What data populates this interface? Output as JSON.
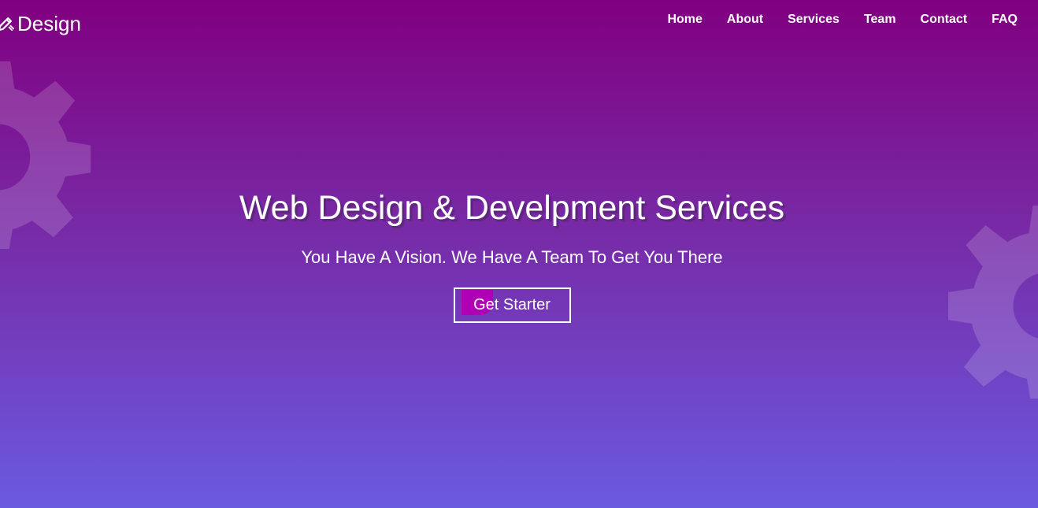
{
  "colors": {
    "gradient_top": "#800080",
    "gradient_bottom": "#6a5ae0",
    "text": "#ffffff",
    "button_accent": "#b000b5"
  },
  "header": {
    "logo_icon": "pencil-ruler-icon",
    "logo_text": "Design",
    "nav": [
      {
        "label": "Home"
      },
      {
        "label": "About"
      },
      {
        "label": "Services"
      },
      {
        "label": "Team"
      },
      {
        "label": "Contact"
      },
      {
        "label": "FAQ"
      }
    ]
  },
  "hero": {
    "title": "Web Design & Develpment Services",
    "subtitle": "You Have A Vision. We Have A Team To Get You There",
    "cta_label": "Get Starter",
    "decorations": [
      "gear-icon",
      "gear-icon"
    ]
  }
}
